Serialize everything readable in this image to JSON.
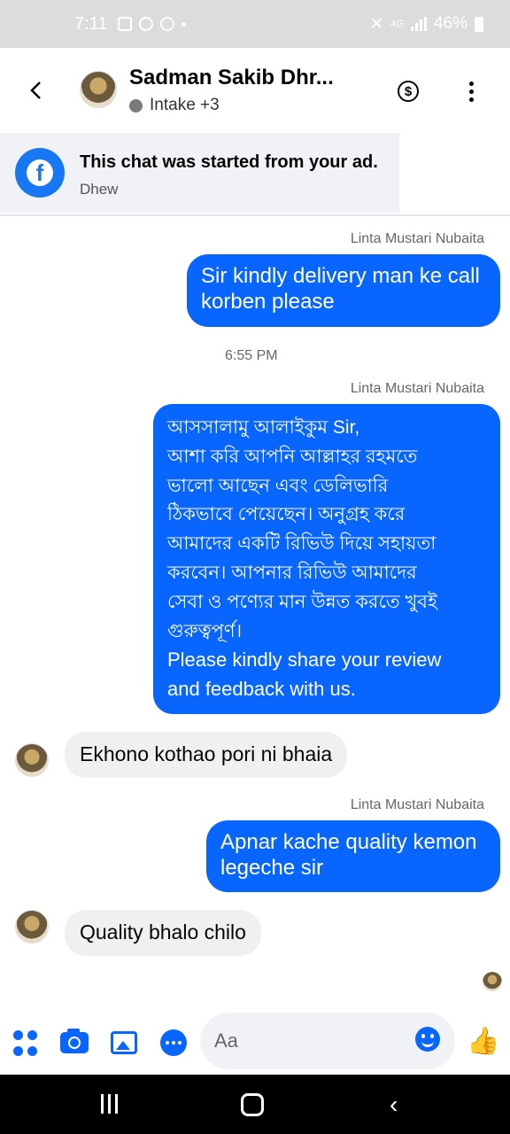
{
  "status_bar": {
    "time": "7:11",
    "battery": "46%",
    "network": "4G"
  },
  "header": {
    "name": "Sadman Sakib Dhr...",
    "subtitle": "Intake +3",
    "back_icon": "chevron-left-icon",
    "money_icon": "dollar-icon",
    "menu_icon": "more-vertical-icon"
  },
  "ad_banner": {
    "title": "This chat was started from your ad.",
    "subtitle": "Dhew"
  },
  "messages": [
    {
      "sender": "Linta Mustari Nubaita",
      "text_lines": [
        "Sir kindly delivery man ke call",
        "korben please"
      ]
    },
    {
      "timestamp": "6:55 PM"
    },
    {
      "sender": "Linta Mustari Nubaita",
      "text_lines": [
        "আসসালামু আলাইকুম Sir,",
        "আশা করি আপনি আল্লাহর রহমতে",
        "ভালো আছেন এবং ডেলিভারি",
        "ঠিকভাবে পেয়েছেন। অনুগ্রহ করে",
        "আমাদের একটি রিভিউ দিয়ে সহায়তা",
        "করবেন। আপনার রিভিউ আমাদের",
        "সেবা ও পণ্যের মান উন্নত করতে খুবই",
        "গুরুত্বপূর্ণ।",
        "Please kindly share your review",
        "and feedback with us."
      ]
    },
    {
      "incoming": "Ekhono kothao pori ni bhaia"
    },
    {
      "sender": "Linta Mustari Nubaita",
      "text_lines": [
        "Apnar kache quality kemon",
        "legeche sir"
      ]
    },
    {
      "incoming": "Quality bhalo chilo"
    }
  ],
  "composer": {
    "placeholder": "Aa"
  },
  "colors": {
    "accent": "#0866ff",
    "incoming_bubble": "#f0f0f0",
    "banner_bg": "#f0f2f5"
  }
}
